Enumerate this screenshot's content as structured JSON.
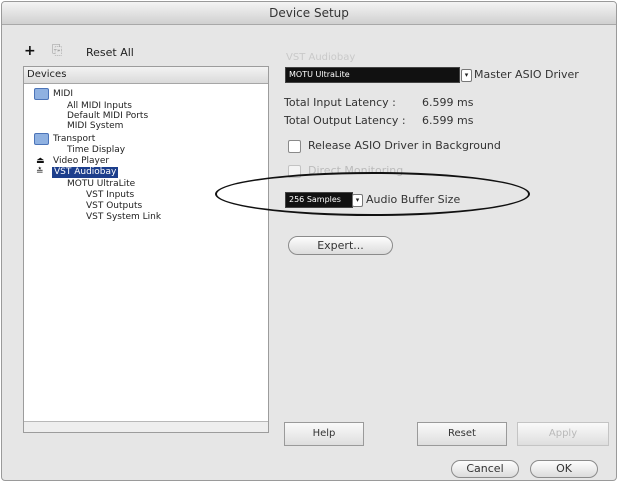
{
  "window": {
    "title": "Device Setup"
  },
  "toolbar": {
    "add_icon": "plus-icon",
    "remove_icon": "minus-icon",
    "reset_all_label": "Reset All"
  },
  "left_panel": {
    "header": "Devices",
    "items": [
      {
        "label": "MIDI",
        "icon": "folder-icon",
        "level": 0
      },
      {
        "label": "All MIDI Inputs",
        "level": 1
      },
      {
        "label": "Default MIDI Ports",
        "level": 1
      },
      {
        "label": "MIDI System",
        "level": 1
      },
      {
        "label": "Transport",
        "icon": "folder-icon",
        "level": 0
      },
      {
        "label": "Time Display",
        "level": 1
      },
      {
        "label": "Video Player",
        "icon": "video-icon",
        "level": 0
      },
      {
        "label": "VST Audiobay",
        "icon": "audio-icon",
        "level": 0,
        "selected": true
      },
      {
        "label": "MOTU UltraLite",
        "level": 1
      },
      {
        "label": "VST Inputs",
        "level": 2
      },
      {
        "label": "VST Outputs",
        "level": 2
      },
      {
        "label": "VST System Link",
        "level": 2
      }
    ]
  },
  "right_panel": {
    "faint_header": "VST Audiobay",
    "driver": {
      "value": "MOTU UltraLite",
      "label": "Master ASIO Driver"
    },
    "latency": {
      "input_label": "Total Input Latency :",
      "input_value": "6.599 ms",
      "output_label": "Total Output Latency :",
      "output_value": "6.599 ms"
    },
    "release_checkbox": {
      "label": "Release ASIO Driver in Background",
      "checked": false
    },
    "direct_monitoring": {
      "label": "Direct Monitoring",
      "checked": false,
      "enabled": false
    },
    "buffer": {
      "value": "256 Samples",
      "label": "Audio Buffer Size"
    },
    "expert_button": "Expert..."
  },
  "bottom": {
    "help": "Help",
    "reset": "Reset",
    "apply": "Apply",
    "cancel": "Cancel",
    "ok": "OK"
  },
  "colors": {
    "selection": "#1c3e8c",
    "window_bg": "#e6e6e6",
    "annotation": "#111111"
  }
}
